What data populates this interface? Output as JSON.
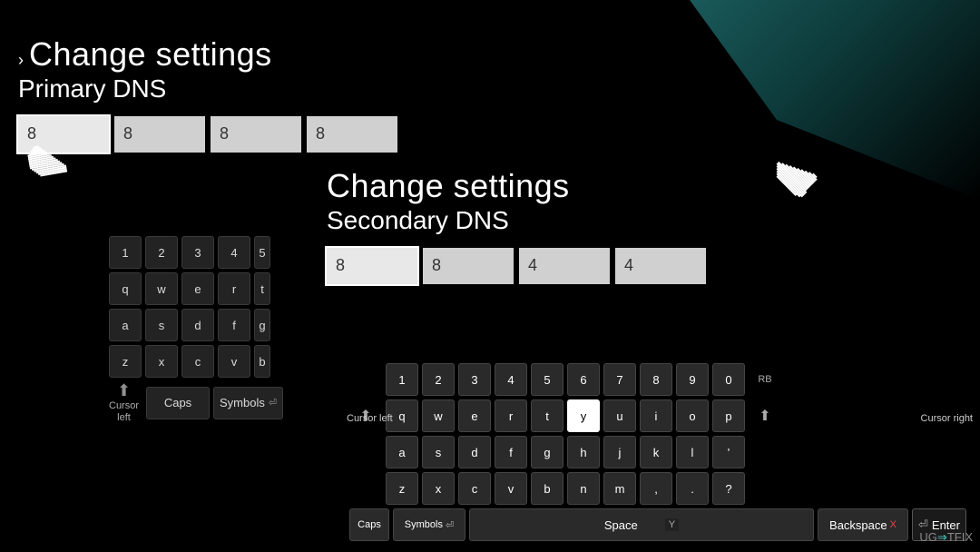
{
  "background": {
    "color": "#000"
  },
  "primary_panel": {
    "chevron": "›",
    "title": "Change settings",
    "subtitle": "Primary DNS",
    "fields": [
      "8",
      "8",
      "8",
      "8"
    ]
  },
  "secondary_panel": {
    "title": "Change settings",
    "subtitle": "Secondary DNS",
    "fields": [
      "8",
      "8",
      "4",
      "4"
    ]
  },
  "keyboard_left": {
    "rows": [
      [
        "1",
        "2",
        "3",
        "4",
        "5"
      ],
      [
        "q",
        "w",
        "e",
        "r",
        "t"
      ],
      [
        "a",
        "s",
        "d",
        "f",
        "g"
      ],
      [
        "z",
        "x",
        "c",
        "v",
        "b"
      ]
    ],
    "bottom_row": {
      "caps": "Caps",
      "symbols": "Symbols"
    },
    "cursor_left_label": "Cursor\nleft"
  },
  "keyboard_right": {
    "number_row": [
      "1",
      "2",
      "3",
      "4",
      "5",
      "6",
      "7",
      "8",
      "9",
      "0"
    ],
    "rows": [
      [
        "q",
        "w",
        "e",
        "r",
        "t",
        "y",
        "u",
        "i",
        "o",
        "p"
      ],
      [
        "a",
        "s",
        "d",
        "f",
        "g",
        "h",
        "j",
        "k",
        "l",
        "'"
      ],
      [
        "z",
        "x",
        "c",
        "v",
        "b",
        "n",
        "m",
        ",",
        ".",
        "?"
      ]
    ],
    "bottom_row": {
      "caps": "Caps",
      "symbols": "Symbols",
      "space": "Space",
      "backspace": "Backspace",
      "enter": "Enter"
    },
    "cursor_left_label": "Cursor\nleft",
    "cursor_right_label": "Cursor\nright",
    "highlighted_key": "y"
  },
  "watermark": {
    "prefix": "UG",
    "accent": "⇒",
    "suffix": "TFIX"
  }
}
